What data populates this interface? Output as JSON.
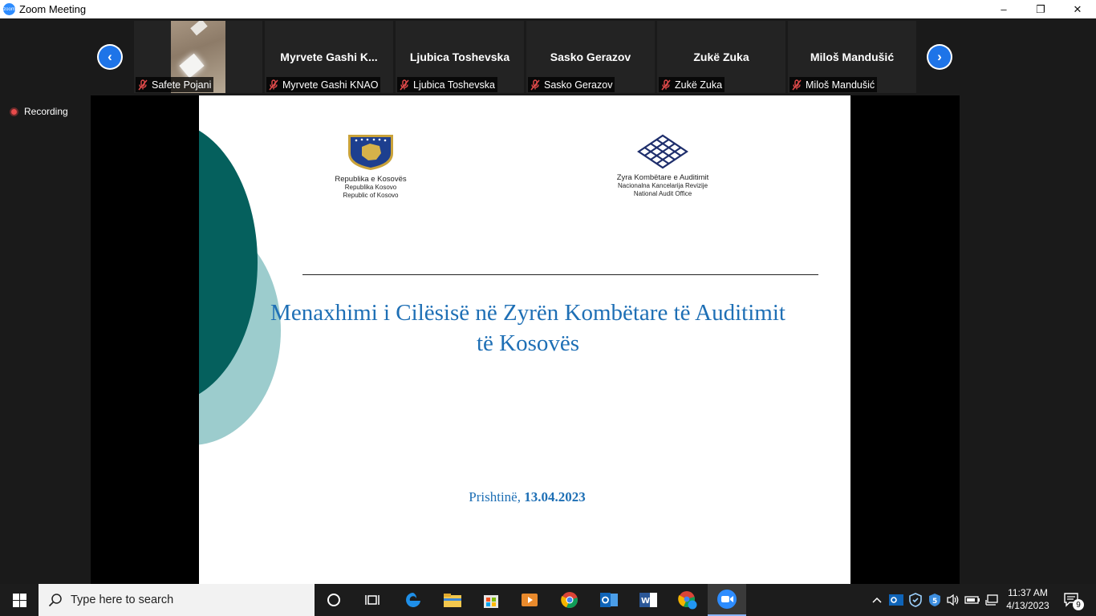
{
  "window": {
    "title": "Zoom Meeting",
    "controls": {
      "minimize": "–",
      "restore": "❐",
      "close": "✕"
    }
  },
  "gallery": {
    "participants": [
      {
        "display": "",
        "label": "Safete Pojani",
        "has_video": true
      },
      {
        "display": "Myrvete Gashi K...",
        "label": "Myrvete Gashi KNAO"
      },
      {
        "display": "Ljubica Toshevska",
        "label": "Ljubica Toshevska"
      },
      {
        "display": "Sasko Gerazov",
        "label": "Sasko Gerazov"
      },
      {
        "display": "Zukë Zuka",
        "label": "Zukë Zuka"
      },
      {
        "display": "Miloš Mandušić",
        "label": "Miloš Mandušić"
      }
    ],
    "prev_arrow": "‹",
    "next_arrow": "›"
  },
  "recording": {
    "label": "Recording"
  },
  "slide": {
    "logo_left": {
      "line1": "Republika e Kosovës",
      "line2": "Republika Kosovo",
      "line3": "Republic of Kosovo"
    },
    "logo_right": {
      "line1": "Zyra Kombëtare e Auditimit",
      "line2": "Nacionalna Kancelarija Revizije",
      "line3": "National Audit Office"
    },
    "title_line1": "Menaxhimi i Cilësisë në Zyrën Kombëtare të Auditimit",
    "title_line2": "të Kosovës",
    "date_place": "Prishtinë, ",
    "date_value": "13.04.2023"
  },
  "taskbar": {
    "search_placeholder": "Type here to search",
    "clock_time": "11:37 AM",
    "clock_date": "4/13/2023",
    "notification_count": "9"
  }
}
